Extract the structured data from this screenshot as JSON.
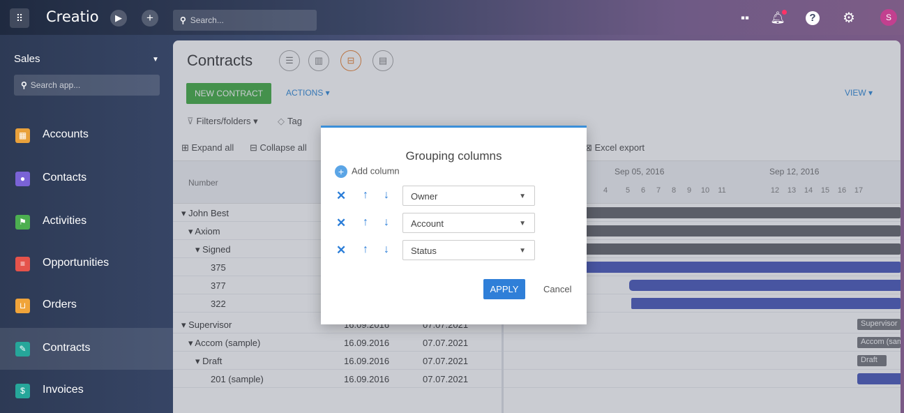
{
  "topbar": {
    "logo": "Creatio",
    "search_placeholder": "Search...",
    "avatar_letter": "S"
  },
  "sidebar": {
    "workspace": "Sales",
    "search_placeholder": "Search app...",
    "items": [
      {
        "label": "Accounts",
        "color": "#e9a13b"
      },
      {
        "label": "Contacts",
        "color": "#7a63d6"
      },
      {
        "label": "Activities",
        "color": "#4caf50"
      },
      {
        "label": "Opportunities",
        "color": "#e5534b"
      },
      {
        "label": "Orders",
        "color": "#f0a43a"
      },
      {
        "label": "Contracts",
        "color": "#26a69a"
      },
      {
        "label": "Invoices",
        "color": "#26a69a"
      }
    ]
  },
  "main": {
    "title": "Contracts",
    "new_button": "NEW CONTRACT",
    "actions": "ACTIONS ▾",
    "view": "VIEW ▾",
    "filters": "Filters/folders ▾",
    "tag": "Tag",
    "expand_all": "Expand all",
    "collapse_all": "Collapse all",
    "excel_export": "Excel export",
    "col_number": "Number",
    "gantt": {
      "weeks": [
        "Sep 05, 2016",
        "Sep 12, 2016"
      ],
      "days": [
        "4",
        "5",
        "6",
        "7",
        "8",
        "9",
        "10",
        "11",
        "12",
        "13",
        "14",
        "15",
        "16",
        "17"
      ]
    },
    "rows": [
      {
        "text": "John Best",
        "d1": "",
        "d2": ""
      },
      {
        "text": "Axiom",
        "d1": "",
        "d2": ""
      },
      {
        "text": "Signed",
        "d1": "",
        "d2": ""
      },
      {
        "text": "375",
        "d1": "",
        "d2": ""
      },
      {
        "text": "377",
        "d1": "",
        "d2": ""
      },
      {
        "text": "322",
        "d1": "",
        "d2": ""
      },
      {
        "text": "Supervisor",
        "d1": "16.09.2016",
        "d2": "07.07.2021"
      },
      {
        "text": "Accom (sample)",
        "d1": "16.09.2016",
        "d2": "07.07.2021"
      },
      {
        "text": "Draft",
        "d1": "16.09.2016",
        "d2": "07.07.2021"
      },
      {
        "text": "201 (sample)",
        "d1": "16.09.2016",
        "d2": "07.07.2021"
      }
    ],
    "gantt_labels": [
      "Supervisor",
      "Accom (sample)",
      "Draft"
    ]
  },
  "modal": {
    "title": "Grouping columns",
    "add_column": "Add column",
    "groups": [
      "Owner",
      "Account",
      "Status"
    ],
    "apply": "APPLY",
    "cancel": "Cancel"
  }
}
